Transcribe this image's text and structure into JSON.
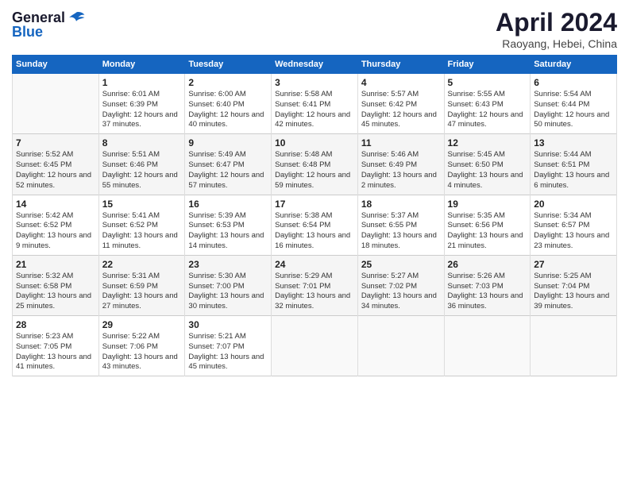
{
  "header": {
    "logo_line1": "General",
    "logo_line2": "Blue",
    "title": "April 2024",
    "subtitle": "Raoyang, Hebei, China"
  },
  "weekdays": [
    "Sunday",
    "Monday",
    "Tuesday",
    "Wednesday",
    "Thursday",
    "Friday",
    "Saturday"
  ],
  "weeks": [
    [
      {
        "day": "",
        "sunrise": "",
        "sunset": "",
        "daylight": ""
      },
      {
        "day": "1",
        "sunrise": "Sunrise: 6:01 AM",
        "sunset": "Sunset: 6:39 PM",
        "daylight": "Daylight: 12 hours and 37 minutes."
      },
      {
        "day": "2",
        "sunrise": "Sunrise: 6:00 AM",
        "sunset": "Sunset: 6:40 PM",
        "daylight": "Daylight: 12 hours and 40 minutes."
      },
      {
        "day": "3",
        "sunrise": "Sunrise: 5:58 AM",
        "sunset": "Sunset: 6:41 PM",
        "daylight": "Daylight: 12 hours and 42 minutes."
      },
      {
        "day": "4",
        "sunrise": "Sunrise: 5:57 AM",
        "sunset": "Sunset: 6:42 PM",
        "daylight": "Daylight: 12 hours and 45 minutes."
      },
      {
        "day": "5",
        "sunrise": "Sunrise: 5:55 AM",
        "sunset": "Sunset: 6:43 PM",
        "daylight": "Daylight: 12 hours and 47 minutes."
      },
      {
        "day": "6",
        "sunrise": "Sunrise: 5:54 AM",
        "sunset": "Sunset: 6:44 PM",
        "daylight": "Daylight: 12 hours and 50 minutes."
      }
    ],
    [
      {
        "day": "7",
        "sunrise": "Sunrise: 5:52 AM",
        "sunset": "Sunset: 6:45 PM",
        "daylight": "Daylight: 12 hours and 52 minutes."
      },
      {
        "day": "8",
        "sunrise": "Sunrise: 5:51 AM",
        "sunset": "Sunset: 6:46 PM",
        "daylight": "Daylight: 12 hours and 55 minutes."
      },
      {
        "day": "9",
        "sunrise": "Sunrise: 5:49 AM",
        "sunset": "Sunset: 6:47 PM",
        "daylight": "Daylight: 12 hours and 57 minutes."
      },
      {
        "day": "10",
        "sunrise": "Sunrise: 5:48 AM",
        "sunset": "Sunset: 6:48 PM",
        "daylight": "Daylight: 12 hours and 59 minutes."
      },
      {
        "day": "11",
        "sunrise": "Sunrise: 5:46 AM",
        "sunset": "Sunset: 6:49 PM",
        "daylight": "Daylight: 13 hours and 2 minutes."
      },
      {
        "day": "12",
        "sunrise": "Sunrise: 5:45 AM",
        "sunset": "Sunset: 6:50 PM",
        "daylight": "Daylight: 13 hours and 4 minutes."
      },
      {
        "day": "13",
        "sunrise": "Sunrise: 5:44 AM",
        "sunset": "Sunset: 6:51 PM",
        "daylight": "Daylight: 13 hours and 6 minutes."
      }
    ],
    [
      {
        "day": "14",
        "sunrise": "Sunrise: 5:42 AM",
        "sunset": "Sunset: 6:52 PM",
        "daylight": "Daylight: 13 hours and 9 minutes."
      },
      {
        "day": "15",
        "sunrise": "Sunrise: 5:41 AM",
        "sunset": "Sunset: 6:52 PM",
        "daylight": "Daylight: 13 hours and 11 minutes."
      },
      {
        "day": "16",
        "sunrise": "Sunrise: 5:39 AM",
        "sunset": "Sunset: 6:53 PM",
        "daylight": "Daylight: 13 hours and 14 minutes."
      },
      {
        "day": "17",
        "sunrise": "Sunrise: 5:38 AM",
        "sunset": "Sunset: 6:54 PM",
        "daylight": "Daylight: 13 hours and 16 minutes."
      },
      {
        "day": "18",
        "sunrise": "Sunrise: 5:37 AM",
        "sunset": "Sunset: 6:55 PM",
        "daylight": "Daylight: 13 hours and 18 minutes."
      },
      {
        "day": "19",
        "sunrise": "Sunrise: 5:35 AM",
        "sunset": "Sunset: 6:56 PM",
        "daylight": "Daylight: 13 hours and 21 minutes."
      },
      {
        "day": "20",
        "sunrise": "Sunrise: 5:34 AM",
        "sunset": "Sunset: 6:57 PM",
        "daylight": "Daylight: 13 hours and 23 minutes."
      }
    ],
    [
      {
        "day": "21",
        "sunrise": "Sunrise: 5:32 AM",
        "sunset": "Sunset: 6:58 PM",
        "daylight": "Daylight: 13 hours and 25 minutes."
      },
      {
        "day": "22",
        "sunrise": "Sunrise: 5:31 AM",
        "sunset": "Sunset: 6:59 PM",
        "daylight": "Daylight: 13 hours and 27 minutes."
      },
      {
        "day": "23",
        "sunrise": "Sunrise: 5:30 AM",
        "sunset": "Sunset: 7:00 PM",
        "daylight": "Daylight: 13 hours and 30 minutes."
      },
      {
        "day": "24",
        "sunrise": "Sunrise: 5:29 AM",
        "sunset": "Sunset: 7:01 PM",
        "daylight": "Daylight: 13 hours and 32 minutes."
      },
      {
        "day": "25",
        "sunrise": "Sunrise: 5:27 AM",
        "sunset": "Sunset: 7:02 PM",
        "daylight": "Daylight: 13 hours and 34 minutes."
      },
      {
        "day": "26",
        "sunrise": "Sunrise: 5:26 AM",
        "sunset": "Sunset: 7:03 PM",
        "daylight": "Daylight: 13 hours and 36 minutes."
      },
      {
        "day": "27",
        "sunrise": "Sunrise: 5:25 AM",
        "sunset": "Sunset: 7:04 PM",
        "daylight": "Daylight: 13 hours and 39 minutes."
      }
    ],
    [
      {
        "day": "28",
        "sunrise": "Sunrise: 5:23 AM",
        "sunset": "Sunset: 7:05 PM",
        "daylight": "Daylight: 13 hours and 41 minutes."
      },
      {
        "day": "29",
        "sunrise": "Sunrise: 5:22 AM",
        "sunset": "Sunset: 7:06 PM",
        "daylight": "Daylight: 13 hours and 43 minutes."
      },
      {
        "day": "30",
        "sunrise": "Sunrise: 5:21 AM",
        "sunset": "Sunset: 7:07 PM",
        "daylight": "Daylight: 13 hours and 45 minutes."
      },
      {
        "day": "",
        "sunrise": "",
        "sunset": "",
        "daylight": ""
      },
      {
        "day": "",
        "sunrise": "",
        "sunset": "",
        "daylight": ""
      },
      {
        "day": "",
        "sunrise": "",
        "sunset": "",
        "daylight": ""
      },
      {
        "day": "",
        "sunrise": "",
        "sunset": "",
        "daylight": ""
      }
    ]
  ]
}
